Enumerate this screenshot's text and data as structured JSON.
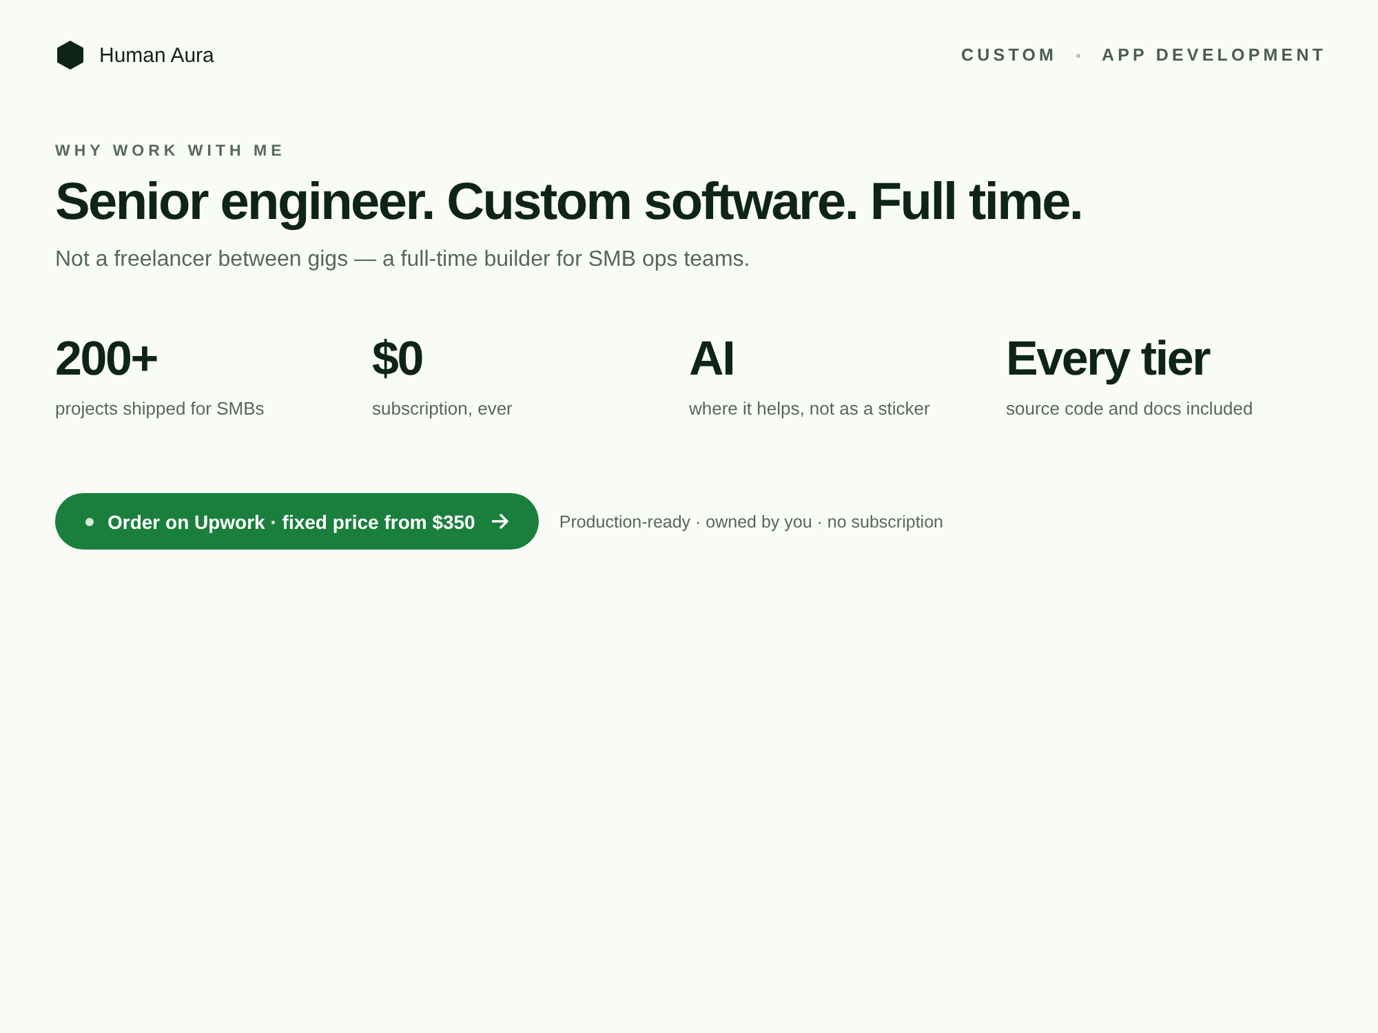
{
  "brand": {
    "name": "Human Aura"
  },
  "nav": {
    "items": [
      {
        "label": "CUSTOM"
      },
      {
        "label": "APP DEVELOPMENT"
      }
    ]
  },
  "hero": {
    "eyebrow": "WHY WORK WITH ME",
    "headline": "Senior engineer. Custom software. Full time.",
    "subheadline": "Not a freelancer between gigs — a full-time builder for SMB ops teams."
  },
  "stats": [
    {
      "value": "200+",
      "label": "projects shipped for SMBs"
    },
    {
      "value": "$0",
      "label": "subscription, ever"
    },
    {
      "value": "AI",
      "label": "where it helps, not as a sticker"
    },
    {
      "value": "Every tier",
      "label": "source code and docs included"
    }
  ],
  "cta": {
    "button": {
      "label": "Order on Upwork · fixed price from $350"
    },
    "note": "Production-ready · owned by you · no subscription"
  }
}
